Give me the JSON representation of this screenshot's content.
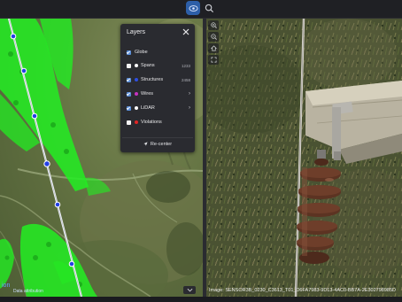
{
  "topbar": {
    "buttons": [
      {
        "icon": "eye-icon",
        "active": true
      },
      {
        "icon": "search-icon",
        "active": false
      }
    ]
  },
  "map": {
    "logo_text": "ion",
    "attribution": "Data attribution"
  },
  "layers_panel": {
    "title": "Layers",
    "items": [
      {
        "label": "Globe",
        "checked": true,
        "dot_color": "",
        "count": "",
        "expandable": false
      },
      {
        "label": "Spans",
        "checked": false,
        "dot_color": "#ffffff",
        "count": "1233",
        "expandable": false
      },
      {
        "label": "Structures",
        "checked": true,
        "dot_color": "#2f4fe0",
        "count": "2458",
        "expandable": false
      },
      {
        "label": "Wires",
        "checked": true,
        "dot_color": "#c533c0",
        "count": "",
        "expandable": true
      },
      {
        "label": "LiDAR",
        "checked": true,
        "dot_color": "#ffffff",
        "count": "",
        "expandable": true
      },
      {
        "label": "Violations",
        "checked": false,
        "dot_color": "#e02525",
        "count": "",
        "expandable": false
      }
    ],
    "recenter_label": "Re-center"
  },
  "photo": {
    "caption": "Image: SENSOR3B_0230_C3613_T01_D6FA7983-9D13-4AC0-BB7A-2E302798985D"
  },
  "colors": {
    "accent": "#2d5fa8",
    "panel_bg": "#2a2b30",
    "lidar_green": "#22ee22"
  }
}
